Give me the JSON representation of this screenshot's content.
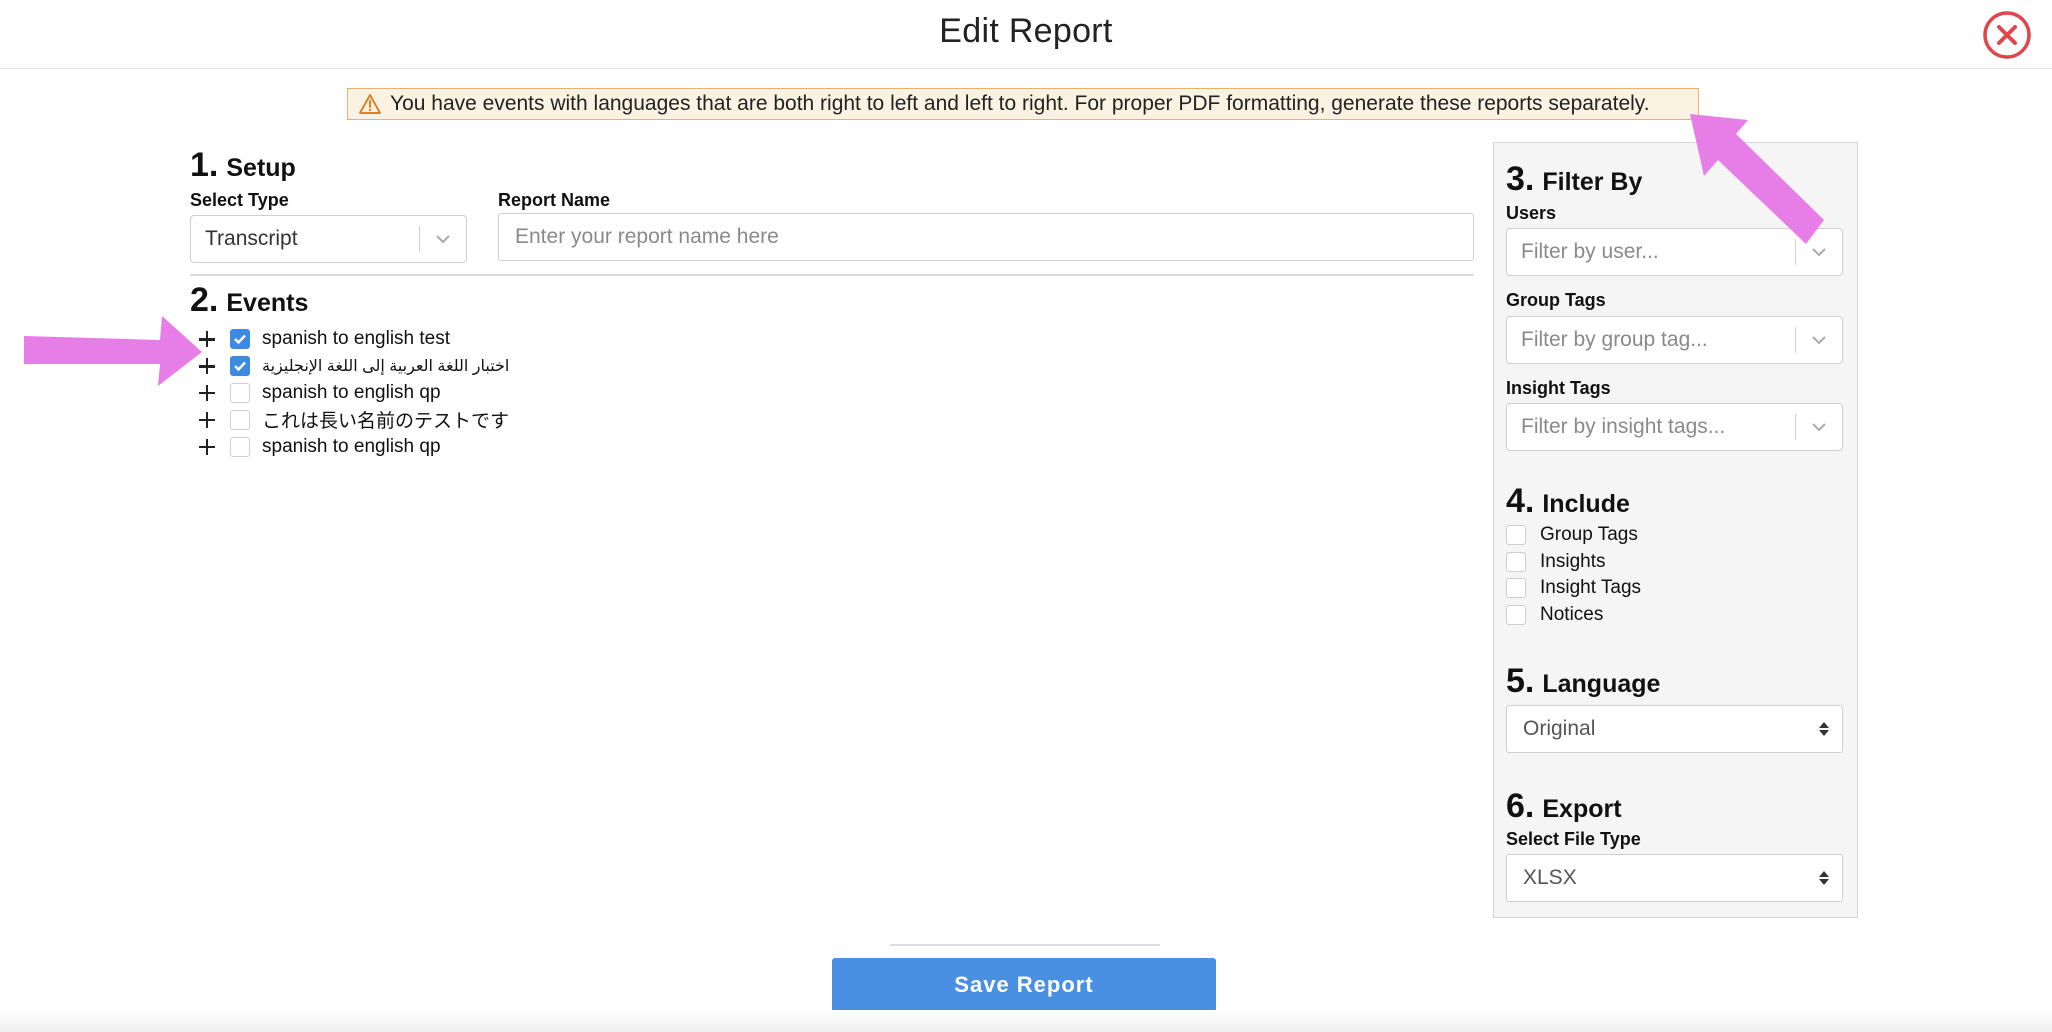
{
  "dialog": {
    "title": "Edit Report"
  },
  "warning": {
    "icon": "warning-triangle-icon",
    "text": "You have events with languages that are both right to left and left to right. For proper PDF formatting, generate these reports separately."
  },
  "setup": {
    "number": "1.",
    "title": "Setup",
    "select_type_label": "Select Type",
    "select_type_value": "Transcript",
    "report_name_label": "Report Name",
    "report_name_placeholder": "Enter your report name here",
    "report_name_value": ""
  },
  "events": {
    "number": "2.",
    "title": "Events",
    "items": [
      {
        "label": "spanish to english test",
        "checked": true
      },
      {
        "label": "اختبار اللغة العربية إلى اللغة الإنجليزية",
        "checked": true
      },
      {
        "label": "spanish to english qp",
        "checked": false
      },
      {
        "label": "これは長い名前のテストです",
        "checked": false
      },
      {
        "label": "spanish to english qp",
        "checked": false
      }
    ]
  },
  "filter_by": {
    "number": "3.",
    "title": "Filter By",
    "users_label": "Users",
    "users_placeholder": "Filter by user...",
    "group_tags_label": "Group Tags",
    "group_tags_placeholder": "Filter by group tag...",
    "insight_tags_label": "Insight Tags",
    "insight_tags_placeholder": "Filter by insight tags..."
  },
  "include": {
    "number": "4.",
    "title": "Include",
    "options": [
      {
        "label": "Group Tags",
        "checked": false
      },
      {
        "label": "Insights",
        "checked": false
      },
      {
        "label": "Insight Tags",
        "checked": false
      },
      {
        "label": "Notices",
        "checked": false
      }
    ]
  },
  "language": {
    "number": "5.",
    "title": "Language",
    "value": "Original"
  },
  "export": {
    "number": "6.",
    "title": "Export",
    "file_type_label": "Select File Type",
    "file_type_value": "XLSX"
  },
  "footer": {
    "save_label": "Save Report"
  },
  "colors": {
    "accent": "#4a90e2",
    "checkbox_checked": "#3d8be0",
    "close_icon": "#e0474c",
    "warning_bg": "#fcf2e2",
    "warning_border": "#e8b26a",
    "annotation_arrow": "#e77ee8"
  }
}
